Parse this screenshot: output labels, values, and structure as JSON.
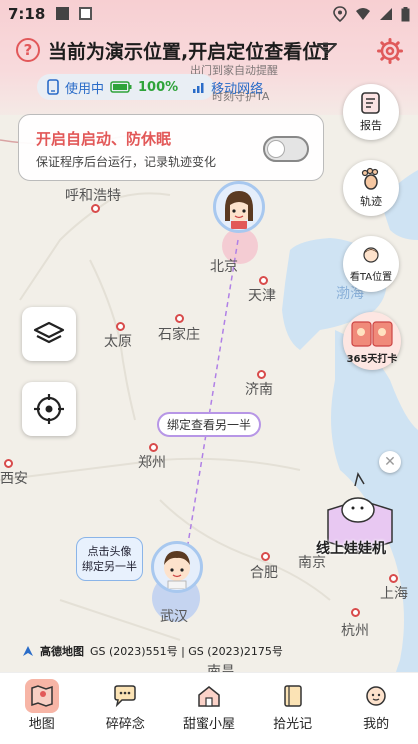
{
  "status_bar": {
    "time": "7:18"
  },
  "header": {
    "help_glyph": "?",
    "location_title": "当前为演示位置,开启定位查看位置",
    "status_pill": {
      "usage": "使用中",
      "battery": "100%",
      "network": "移动网络"
    },
    "faded_notice": {
      "line1": "出门到家自动提醒",
      "line2": "时刻守护TA"
    }
  },
  "notice": {
    "title": "开启自启动、防休眠",
    "description": "保证程序后台运行，记录轨迹变化",
    "toggle_on": false
  },
  "side_buttons": {
    "report": "报告",
    "track": "轨迹",
    "view_ta": "看TA位置",
    "checkin": "365天打卡"
  },
  "cities": {
    "huhehaote": "呼和浩特",
    "beijing": "北京",
    "tianjin": "天津",
    "taiyuan": "太原",
    "shijiazhuang": "石家庄",
    "jinan": "济南",
    "zhengzhou": "郑州",
    "xian": "西安",
    "hefei": "合肥",
    "nanjing": "南京",
    "shanghai": "上海",
    "hangzhou": "杭州",
    "wuhan": "武汉",
    "nanchang": "南昌",
    "bohai": "渤海"
  },
  "map_overlay": {
    "bind_pill": "绑定查看另一半",
    "bubble": {
      "line1": "点击头像",
      "line2": "绑定另一半"
    },
    "doll_label": "线上娃娃机",
    "close_glyph": "✕"
  },
  "copyright": {
    "logo": "高德地图",
    "text": "GS (2023)551号 | GS (2023)2175号"
  },
  "tabs": [
    "地图",
    "碎碎念",
    "甜蜜小屋",
    "拾光记",
    "我的"
  ],
  "colors": {
    "accent_red": "#e25858",
    "pill_blue": "#2a6cc8",
    "battery_green": "#2fa33a",
    "purple_line": "#b796e6"
  }
}
